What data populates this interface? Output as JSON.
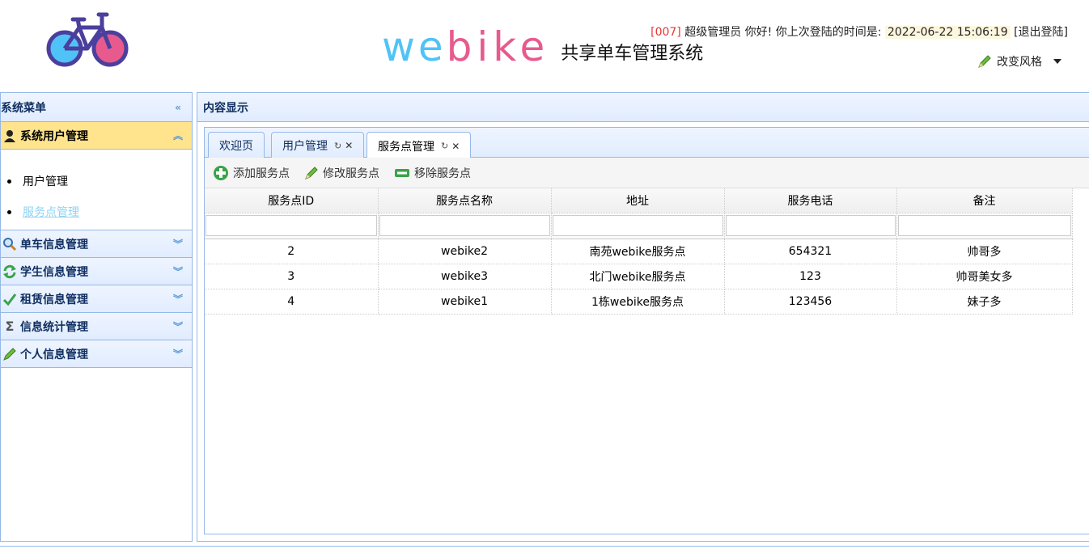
{
  "header": {
    "brand_web": "we",
    "brand_bike": "bike",
    "subtitle": "共享单车管理系统",
    "user_id": "[007]",
    "greeting": "超级管理员 你好! 你上次登陆的时间是:",
    "last_login": "2022-06-22 15:06:19",
    "logout": "[退出登陆]",
    "style_switch": "改变风格"
  },
  "west": {
    "title": "系统菜单",
    "sections": [
      {
        "label": "系统用户管理",
        "icon": "user-icon",
        "items": [
          {
            "label": "用户管理"
          },
          {
            "label": "服务点管理"
          }
        ]
      },
      {
        "label": "单车信息管理",
        "icon": "magnifier-icon"
      },
      {
        "label": "学生信息管理",
        "icon": "refresh-icon"
      },
      {
        "label": "租赁信息管理",
        "icon": "checkmark-icon"
      },
      {
        "label": "信息统计管理",
        "icon": "sigma-icon"
      },
      {
        "label": "个人信息管理",
        "icon": "pencil-icon"
      }
    ]
  },
  "center": {
    "title": "内容显示",
    "tabs": [
      {
        "label": "欢迎页"
      },
      {
        "label": "用户管理"
      },
      {
        "label": "服务点管理"
      }
    ],
    "toolbar": {
      "add": "添加服务点",
      "edit": "修改服务点",
      "remove": "移除服务点"
    },
    "table": {
      "columns": [
        "服务点ID",
        "服务点名称",
        "地址",
        "服务电话",
        "备注"
      ],
      "rows": [
        [
          "2",
          "webike2",
          "南苑webike服务点",
          "654321",
          "帅哥多"
        ],
        [
          "3",
          "webike3",
          "北门webike服务点",
          "123",
          "帅哥美女多"
        ],
        [
          "4",
          "webike1",
          "1栋webike服务点",
          "123456",
          "妹子多"
        ]
      ]
    }
  },
  "colors": {
    "accent_border": "#95b8e7",
    "active_section": "#ffe48d",
    "brand_blue": "#4fc3f7",
    "brand_pink": "#e85a8e"
  }
}
